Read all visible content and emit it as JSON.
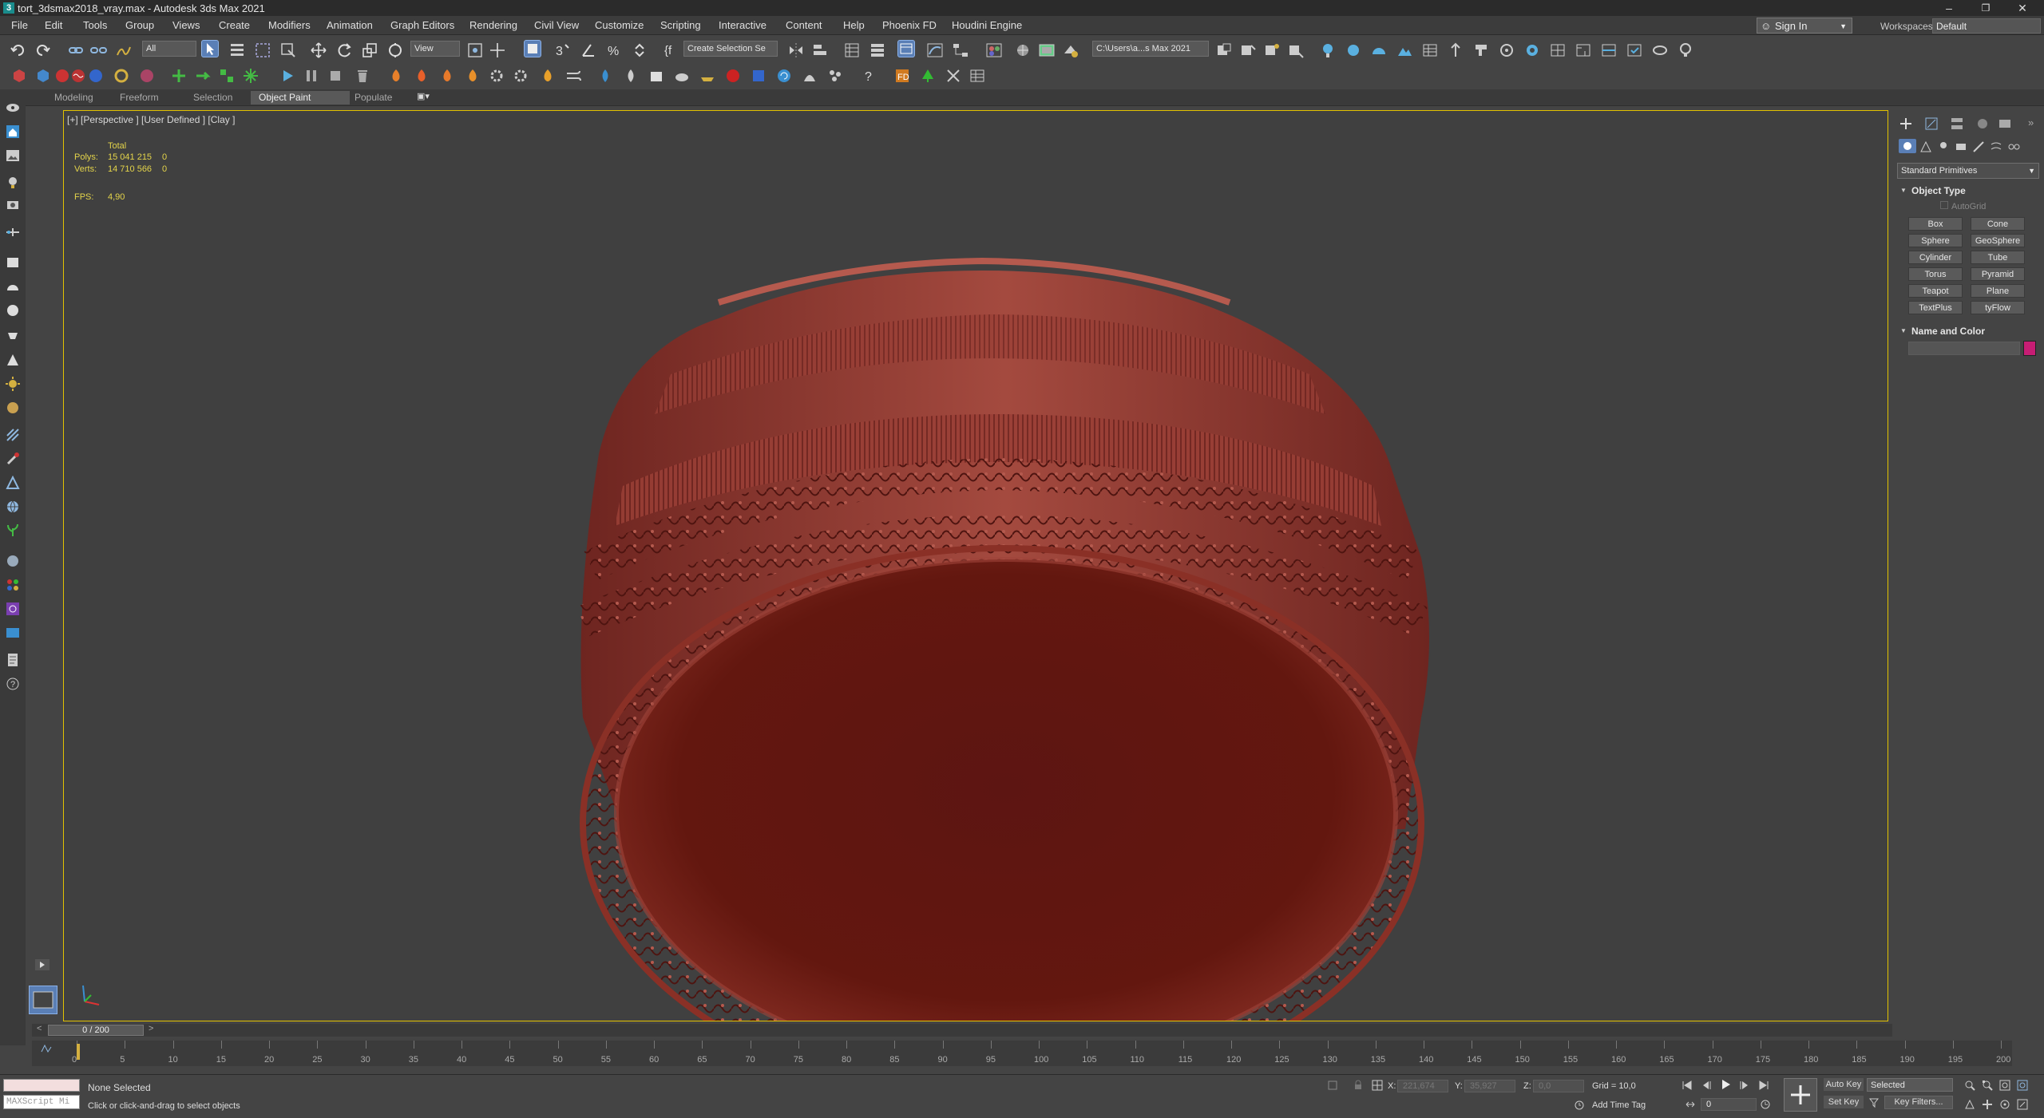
{
  "window": {
    "title": "tort_3dsmax2018_vray.max - Autodesk 3ds Max 2021",
    "app_icon": "3",
    "minimize": "–",
    "restore": "❐",
    "close": "✕"
  },
  "menu": [
    "File",
    "Edit",
    "Tools",
    "Group",
    "Views",
    "Create",
    "Modifiers",
    "Animation",
    "Graph Editors",
    "Rendering",
    "Civil View",
    "Customize",
    "Scripting",
    "Interactive",
    "Content",
    "Help",
    "Phoenix FD",
    "Houdini Engine"
  ],
  "signin": {
    "label": "Sign In"
  },
  "workspace": {
    "label": "Workspaces:",
    "value": "Default"
  },
  "toolbar": {
    "selection_filter": "All",
    "ref_coord": "View",
    "named_selection": "Create Selection Se",
    "project_path": "C:\\Users\\a...s Max 2021"
  },
  "ribbon": {
    "tabs": [
      {
        "label": "Modeling",
        "active": false
      },
      {
        "label": "Freeform",
        "active": false
      },
      {
        "label": "Selection",
        "active": false
      },
      {
        "label": "Object Paint",
        "active": true
      },
      {
        "label": "Populate",
        "active": false
      }
    ]
  },
  "viewport": {
    "label": "[+] [Perspective ] [User Defined ] [Clay ]",
    "stats": {
      "total_label": "Total",
      "polys_label": "Polys:",
      "polys_value": "15 041 215",
      "polys_sel": "0",
      "verts_label": "Verts:",
      "verts_value": "14 710 566",
      "verts_sel": "0",
      "fps_label": "FPS:",
      "fps_value": "4,90"
    },
    "model_color": "#8a2e2a",
    "border_color": "#e3c200"
  },
  "command_panel": {
    "category": "Standard Primitives",
    "object_type_title": "Object Type",
    "autogrid": "AutoGrid",
    "buttons": [
      "Box",
      "Cone",
      "Sphere",
      "GeoSphere",
      "Cylinder",
      "Tube",
      "Torus",
      "Pyramid",
      "Teapot",
      "Plane",
      "TextPlus",
      "tyFlow"
    ],
    "name_color_title": "Name and Color",
    "swatch_color": "#c71d74"
  },
  "time_slider": {
    "label": "0 / 200",
    "prev": "<",
    "next": ">"
  },
  "timeline": {
    "ticks": [
      "0",
      "5",
      "10",
      "15",
      "20",
      "25",
      "30",
      "35",
      "40",
      "45",
      "50",
      "55",
      "60",
      "65",
      "70",
      "75",
      "80",
      "85",
      "90",
      "95",
      "100",
      "105",
      "110",
      "115",
      "120",
      "125",
      "130",
      "135",
      "140",
      "145",
      "150",
      "155",
      "160",
      "165",
      "170",
      "175",
      "180",
      "185",
      "190",
      "195",
      "200"
    ]
  },
  "status": {
    "maxscript_placeholder": "MAXScript Mi",
    "selection": "None Selected",
    "prompt": "Click or click-and-drag to select objects",
    "x_label": "X:",
    "x_value": "221,674",
    "y_label": "Y:",
    "y_value": "35,927",
    "z_label": "Z:",
    "z_value": "0,0",
    "grid": "Grid = 10,0",
    "add_time_tag": "Add Time Tag",
    "auto_key": "Auto Key",
    "set_key": "Set Key",
    "key_mode": "Selected",
    "key_filters": "Key Filters...",
    "frame": "0"
  }
}
